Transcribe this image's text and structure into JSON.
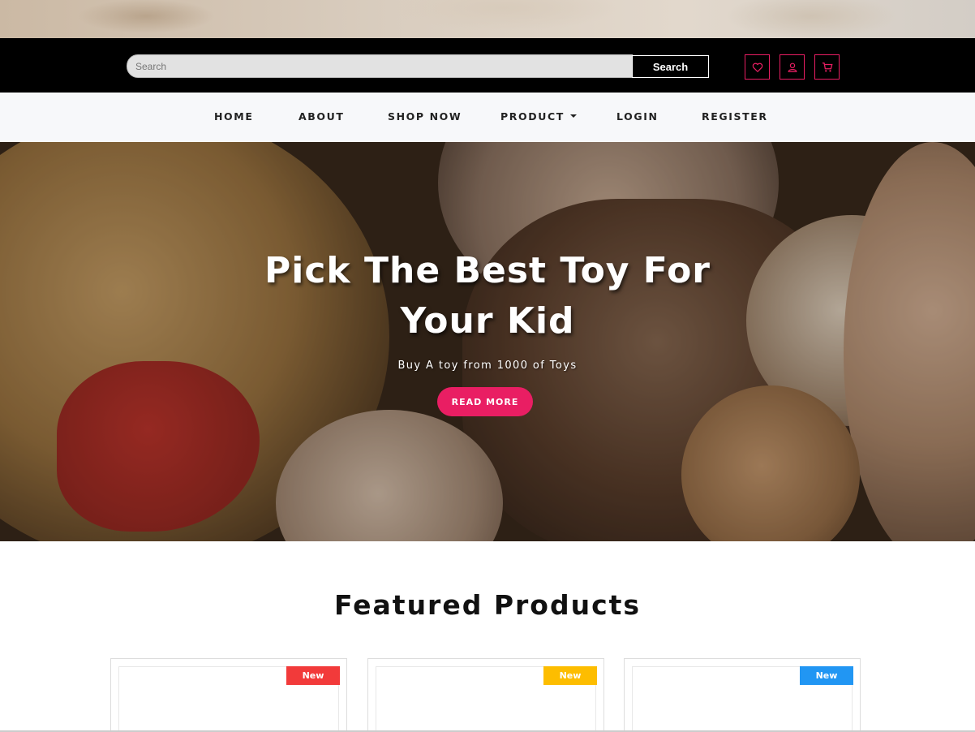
{
  "search": {
    "placeholder": "Search",
    "button_label": "Search"
  },
  "header_icons": [
    "heart-icon",
    "user-icon",
    "cart-icon"
  ],
  "nav": {
    "items": [
      {
        "label": "HOME"
      },
      {
        "label": "ABOUT"
      },
      {
        "label": "SHOP NOW"
      },
      {
        "label": "PRODUCT"
      },
      {
        "label": "LOGIN"
      },
      {
        "label": "REGISTER"
      }
    ]
  },
  "hero": {
    "title": "Pick The Best Toy For Your Kid",
    "subtitle": "Buy A toy from 1000 of Toys",
    "button_label": "READ MORE"
  },
  "featured": {
    "title": "Featured Products",
    "cards": [
      {
        "badge": "New",
        "badge_color": "#f23a3a"
      },
      {
        "badge": "New",
        "badge_color": "#fdbd00"
      },
      {
        "badge": "New",
        "badge_color": "#2196f3"
      }
    ]
  },
  "colors": {
    "accent": "#e91e63",
    "header_bg": "#000000",
    "nav_bg": "#f7f8fa"
  }
}
